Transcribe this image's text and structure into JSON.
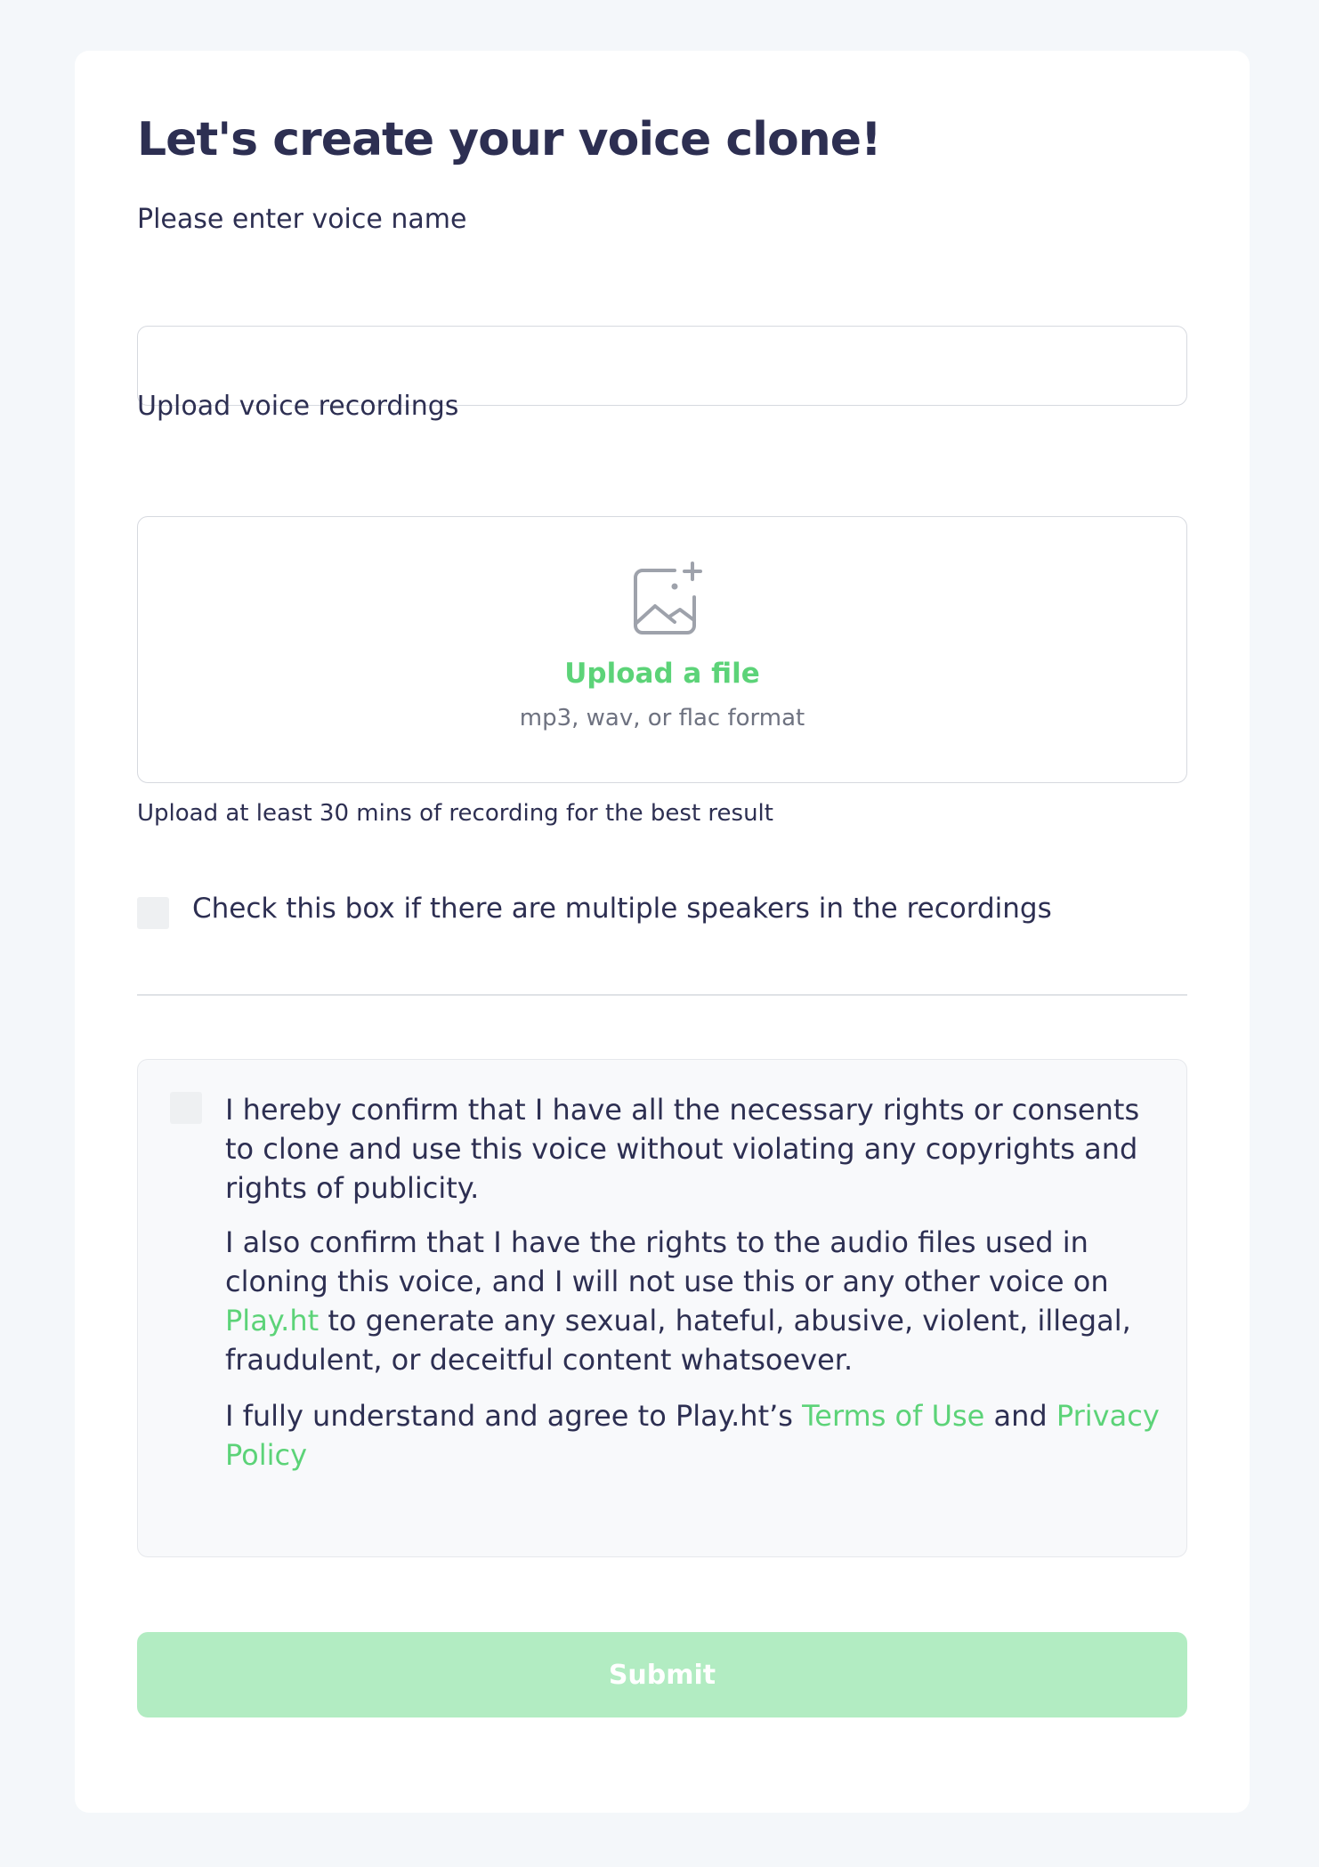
{
  "form": {
    "title": "Let's create your voice clone!",
    "voice_name_label": "Please enter voice name",
    "voice_name_value": "",
    "voice_name_placeholder": "",
    "upload_label": "Upload voice recordings",
    "upload_icon": "image-plus-icon",
    "upload_link": "Upload a file",
    "upload_formats": "mp3, wav, or flac format",
    "upload_helper": "Upload at least 30 mins of recording for the best result",
    "multi_speaker_label": "Check this box if there are multiple speakers in the recordings",
    "multi_speaker_checked": false,
    "submit_label": "Submit"
  },
  "consent": {
    "checked": false,
    "p1": "I hereby confirm that I have all the necessary rights or consents to clone and use this voice without violating any copyrights and rights of publicity.",
    "p2_before": "I also confirm that I have the rights to the audio files used in cloning this voice, and I will not use this or any other voice on ",
    "p2_link": "Play.ht",
    "p2_after": " to generate any sexual, hateful, abusive, violent, illegal, fraudulent, or deceitful content whatsoever.",
    "p3_before": "I fully understand and agree to Play.ht’s ",
    "terms_link": "Terms of Use",
    "p3_and": " and ",
    "privacy_link": "Privacy Policy"
  },
  "colors": {
    "accent": "#5cd378",
    "submit_disabled": "#b2ecc2",
    "text": "#2d2f52",
    "background": "#f4f7fa"
  }
}
